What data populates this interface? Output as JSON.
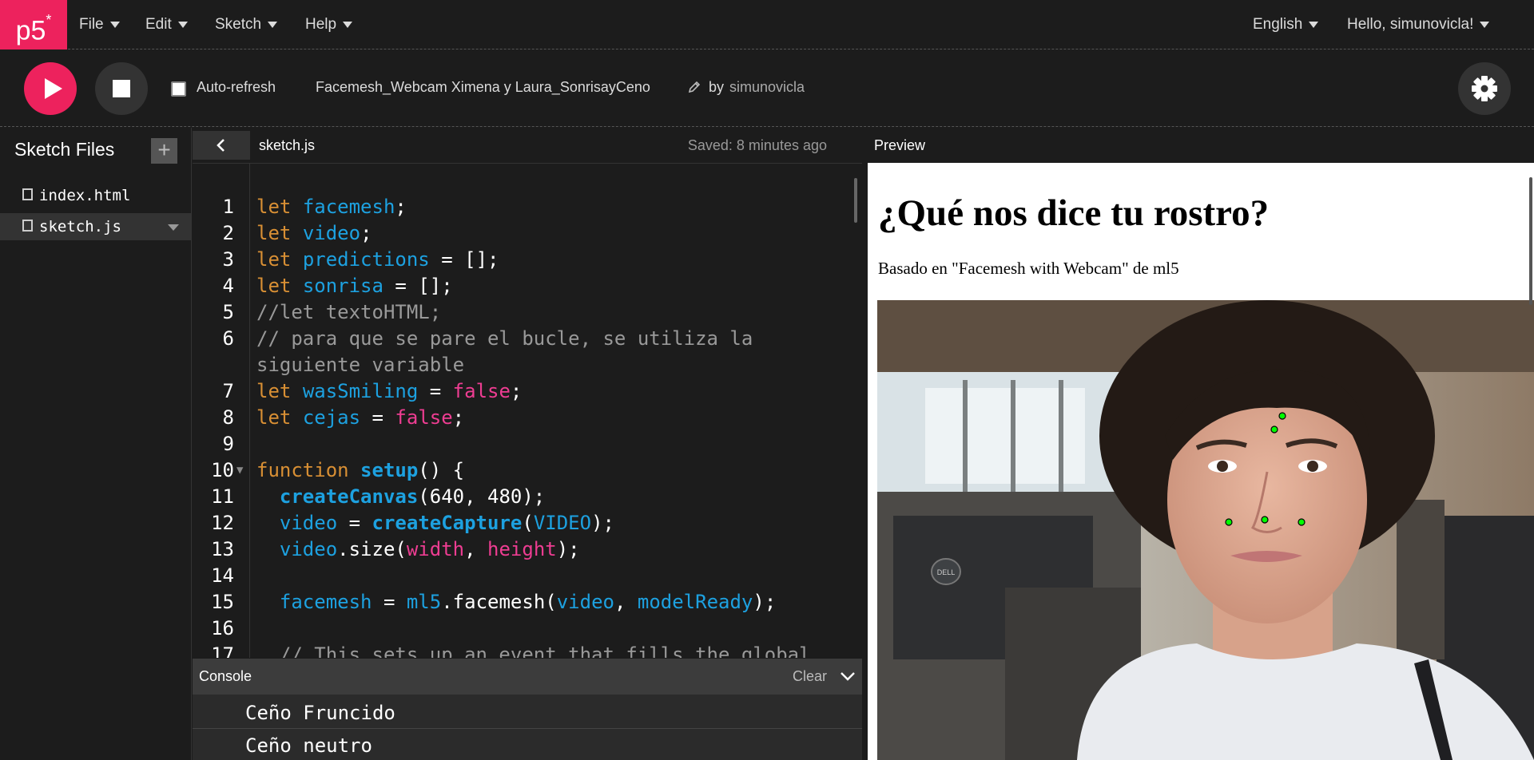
{
  "nav": {
    "logo": "p5",
    "menus": [
      "File",
      "Edit",
      "Sketch",
      "Help"
    ],
    "language": "English",
    "user_greeting": "Hello, simunovicla!"
  },
  "toolbar": {
    "auto_refresh_label": "Auto-refresh",
    "auto_refresh_checked": false,
    "sketch_name": "Facemesh_Webcam Ximena y Laura_SonrisayCeno",
    "by_label": "by",
    "author": "simunovicla"
  },
  "sidebar": {
    "title": "Sketch Files",
    "files": [
      {
        "name": "index.html",
        "selected": false
      },
      {
        "name": "sketch.js",
        "selected": true
      }
    ]
  },
  "editor": {
    "filename": "sketch.js",
    "saved_status": "Saved: 8 minutes ago",
    "lines": [
      {
        "number": "1",
        "text": "let facemesh;"
      },
      {
        "number": "2",
        "text": "let video;"
      },
      {
        "number": "3",
        "text": "let predictions = [];"
      },
      {
        "number": "4",
        "text": "let sonrisa = [];"
      },
      {
        "number": "5",
        "text": "//let textoHTML;"
      },
      {
        "number": "6",
        "text": "// para que se pare el bucle, se utiliza la siguiente variable"
      },
      {
        "number": "7",
        "text": "let wasSmiling = false;"
      },
      {
        "number": "8",
        "text": "let cejas = false;"
      },
      {
        "number": "9",
        "text": ""
      },
      {
        "number": "10",
        "text": "function setup() {"
      },
      {
        "number": "11",
        "text": "createCanvas(640, 480);"
      },
      {
        "number": "12",
        "text": "video = createCapture(VIDEO);"
      },
      {
        "number": "13",
        "text": "video.size(width, height);"
      },
      {
        "number": "14",
        "text": ""
      },
      {
        "number": "15",
        "text": "facemesh = ml5.facemesh(video, modelReady);"
      },
      {
        "number": "16",
        "text": ""
      },
      {
        "number": "17",
        "text": "// This sets up an event that fills the global"
      }
    ]
  },
  "console": {
    "title": "Console",
    "clear_label": "Clear",
    "messages": [
      "Ceño Fruncido",
      "Ceño neutro"
    ]
  },
  "preview": {
    "title": "Preview",
    "heading": "¿Qué nos dice tu rostro?",
    "subtitle": "Basado en \"Facemesh with Webcam\" de ml5",
    "webcam_monitor_brand": "DELL",
    "landmark_color": "#00ff00"
  },
  "colors": {
    "accent": "#ed225d",
    "background": "#1c1c1c",
    "keyword": "#d88f34",
    "variable": "#1da1e0",
    "literal": "#ee3d92",
    "comment": "#999999"
  },
  "icons": {
    "play": "play-icon",
    "stop": "stop-icon",
    "edit": "pencil-icon",
    "settings": "gear-icon",
    "add_file": "plus-icon",
    "file": "file-icon",
    "collapse": "chevron-left-icon",
    "console_toggle": "chevron-down-icon"
  }
}
